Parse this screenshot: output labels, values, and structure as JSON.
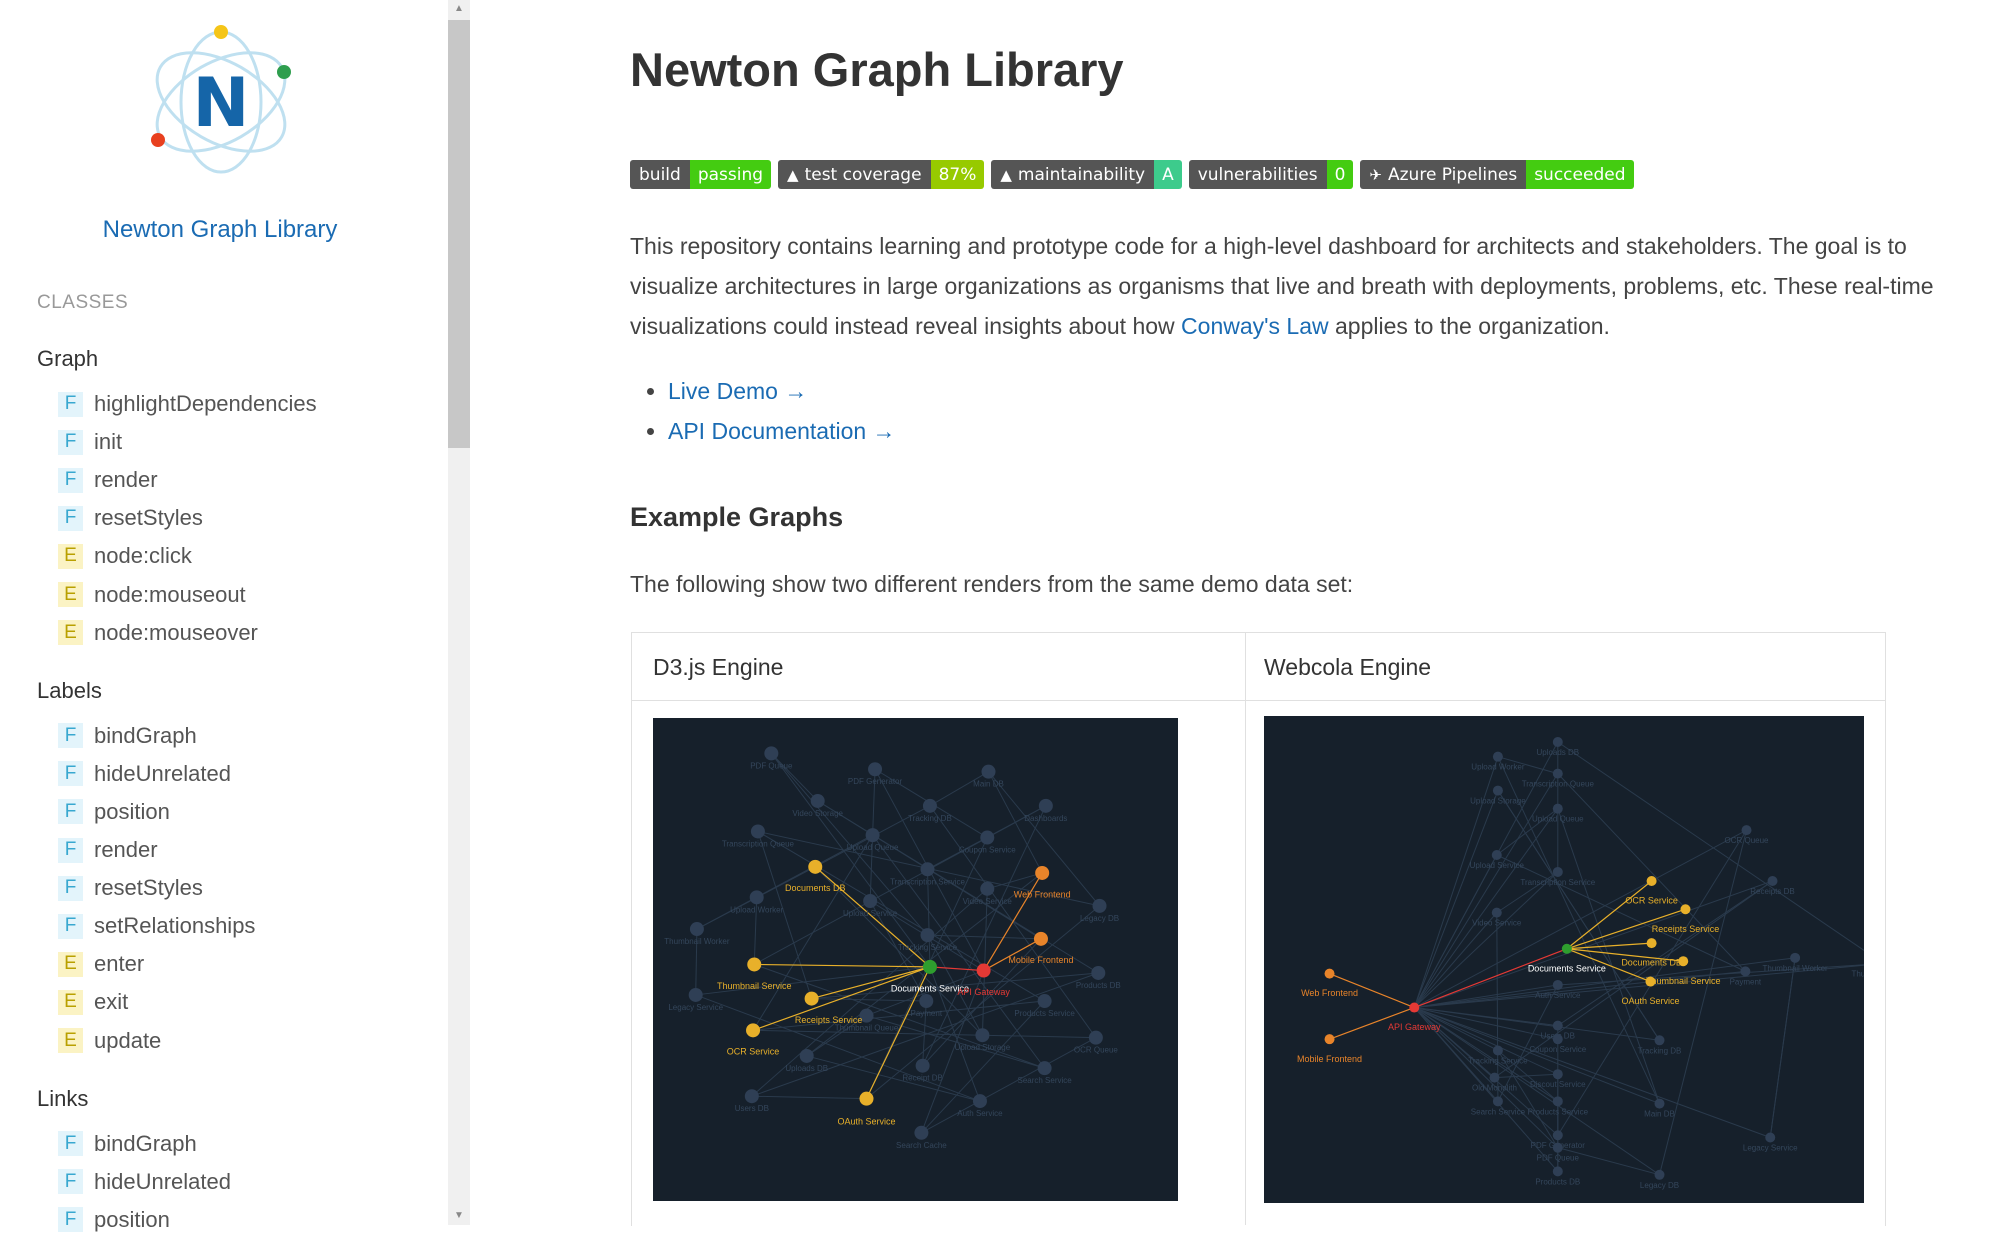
{
  "sidebar": {
    "logo_letter": "N",
    "brand": "Newton Graph Library",
    "section_label": "CLASSES",
    "groups": [
      {
        "title": "Graph",
        "items": [
          {
            "kind": "F",
            "label": "highlightDependencies"
          },
          {
            "kind": "F",
            "label": "init"
          },
          {
            "kind": "F",
            "label": "render"
          },
          {
            "kind": "F",
            "label": "resetStyles"
          },
          {
            "kind": "E",
            "label": "node:click"
          },
          {
            "kind": "E",
            "label": "node:mouseout"
          },
          {
            "kind": "E",
            "label": "node:mouseover"
          }
        ]
      },
      {
        "title": "Labels",
        "items": [
          {
            "kind": "F",
            "label": "bindGraph"
          },
          {
            "kind": "F",
            "label": "hideUnrelated"
          },
          {
            "kind": "F",
            "label": "position"
          },
          {
            "kind": "F",
            "label": "render"
          },
          {
            "kind": "F",
            "label": "resetStyles"
          },
          {
            "kind": "F",
            "label": "setRelationships"
          },
          {
            "kind": "E",
            "label": "enter"
          },
          {
            "kind": "E",
            "label": "exit"
          },
          {
            "kind": "E",
            "label": "update"
          }
        ]
      },
      {
        "title": "Links",
        "items": [
          {
            "kind": "F",
            "label": "bindGraph"
          },
          {
            "kind": "F",
            "label": "hideUnrelated"
          },
          {
            "kind": "F",
            "label": "position"
          }
        ]
      }
    ]
  },
  "main": {
    "title": "Newton Graph Library",
    "badges": [
      {
        "left": "build",
        "right": "passing",
        "color": "#4c1",
        "icon": ""
      },
      {
        "left": "test coverage",
        "right": "87%",
        "color": "#97ca00",
        "icon": "codeclimate-icon"
      },
      {
        "left": "maintainability",
        "right": "A",
        "color": "#3dcb8c",
        "icon": "codeclimate-icon"
      },
      {
        "left": "vulnerabilities",
        "right": "0",
        "color": "#4c1",
        "icon": ""
      },
      {
        "left": "Azure Pipelines",
        "right": "succeeded",
        "color": "#4c1",
        "icon": "rocket-icon"
      }
    ],
    "intro_before": "This repository contains learning and prototype code for a high-level dashboard for architects and stakeholders. The goal is to visualize architectures in large organizations as organisms that live and breath with deployments, problems, etc. These real-time visualizations could instead reveal insights about how ",
    "intro_link": "Conway's Law",
    "intro_after": " applies to the organization.",
    "links": [
      "Live Demo →",
      "API Documentation →"
    ],
    "example_heading": "Example Graphs",
    "following": "The following show two different renders from the same demo data set:",
    "table": {
      "col1": "D3.js Engine",
      "col2": "Webcola Engine"
    }
  },
  "graphs": {
    "d3": {
      "highlighted": [
        {
          "label": "Documents Service",
          "color": "#ffffff",
          "node": "#2e9e2e"
        },
        {
          "label": "API Gateway",
          "color": "#e53935",
          "node": "#e53935"
        },
        {
          "label": "Web Frontend",
          "color": "#e8842a",
          "node": "#e8842a"
        },
        {
          "label": "Mobile Frontend",
          "color": "#e8842a",
          "node": "#e8842a"
        },
        {
          "label": "Documents DB",
          "color": "#e8b02a",
          "node": "#e8b02a"
        },
        {
          "label": "Thumbnail Service",
          "color": "#e8b02a",
          "node": "#e8b02a"
        },
        {
          "label": "Receipts Service",
          "color": "#e8b02a",
          "node": "#e8b02a"
        },
        {
          "label": "OCR Service",
          "color": "#e8b02a",
          "node": "#e8b02a"
        },
        {
          "label": "OAuth Service",
          "color": "#e8b02a",
          "node": "#e8b02a"
        }
      ],
      "dim_labels": [
        "PDF Queue",
        "PDF Generator",
        "Main DB",
        "Video Storage",
        "Tracking DB",
        "Dashboards",
        "Transcription Queue",
        "Upload Queue",
        "Coupon Service",
        "Transcription Service",
        "Upload Service",
        "Video Service",
        "Tracking Service",
        "Thumbnail Worker",
        "Upload Worker",
        "Payment",
        "Products Service",
        "Legacy DB",
        "Legacy Service",
        "Thumbnail Queue",
        "Uploads DB",
        "Receipt DB",
        "Upload Storage",
        "Search Service",
        "Products DB",
        "OCR Queue",
        "Users DB",
        "Auth Service",
        "Search Cache"
      ]
    },
    "cola": {
      "highlighted": [
        {
          "label": "Documents Service",
          "color": "#ffffff",
          "node": "#2e9e2e"
        },
        {
          "label": "API Gateway",
          "color": "#e53935",
          "node": "#e53935"
        },
        {
          "label": "Web Frontend",
          "color": "#e8842a",
          "node": "#e8842a"
        },
        {
          "label": "Mobile Frontend",
          "color": "#e8842a",
          "node": "#e8842a"
        },
        {
          "label": "OCR Service",
          "color": "#e8b02a",
          "node": "#e8b02a"
        },
        {
          "label": "Receipts Service",
          "color": "#e8b02a",
          "node": "#e8b02a"
        },
        {
          "label": "Documents DB",
          "color": "#e8b02a",
          "node": "#e8b02a"
        },
        {
          "label": "Thumbnail Service",
          "color": "#e8b02a",
          "node": "#e8b02a"
        },
        {
          "label": "OAuth Service",
          "color": "#e8b02a",
          "node": "#e8b02a"
        }
      ],
      "dim_labels": [
        "Upload Worker",
        "Uploads DB",
        "Transcription Queue",
        "Upload Storage",
        "Upload Queue",
        "OCR Queue",
        "Upload Service",
        "Transcription Service",
        "Receipts DB",
        "Video Service",
        "Thumbnail Worker",
        "Thumbnail Queue",
        "Payment",
        "Auth Service",
        "Users DB",
        "Tracking Service",
        "Coupon Service",
        "Tracking DB",
        "Old Monolith",
        "Search Service",
        "Discout Service",
        "Products Service",
        "Main DB",
        "PDF Generator",
        "Legacy Service",
        "PDF Queue",
        "Products DB",
        "Legacy DB"
      ]
    }
  }
}
